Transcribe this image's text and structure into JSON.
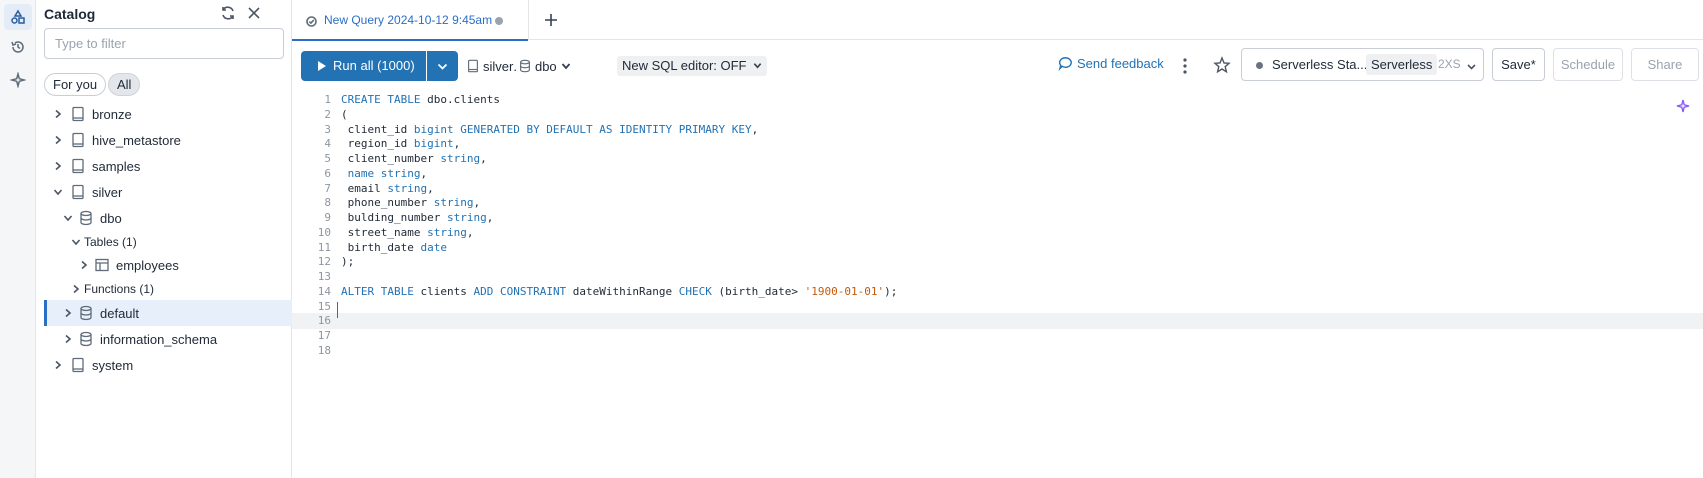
{
  "catalog": {
    "title": "Catalog",
    "filter_placeholder": "Type to filter",
    "pills": [
      "For you",
      "All"
    ],
    "items": {
      "bronze": "bronze",
      "hive_metastore": "hive_metastore",
      "samples": "samples",
      "silver": "silver",
      "dbo": "dbo",
      "tables": "Tables (1)",
      "employees": "employees",
      "functions": "Functions (1)",
      "default": "default",
      "information_schema": "information_schema",
      "system": "system"
    }
  },
  "tabs": [
    {
      "label": "New Query 2024-10-12 9:45am"
    }
  ],
  "toolbar": {
    "run_label": "Run all (1000)",
    "catalog": "silver",
    "schema": "dbo",
    "sql_editor_toggle": "New SQL editor: OFF",
    "feedback": "Send feedback",
    "compute_name": "Serverless Sta...",
    "compute_type": "Serverless",
    "compute_size": "2XS",
    "save": "Save*",
    "schedule": "Schedule",
    "share": "Share"
  },
  "editor": {
    "current_line": 16,
    "lines": [
      "<span class=\"kw\">CREATE TABLE</span> dbo.clients",
      "(",
      " client_id <span class=\"kw\">bigint GENERATED BY DEFAULT AS IDENTITY PRIMARY KEY</span>,",
      " region_id <span class=\"kw\">bigint</span>,",
      " client_number <span class=\"kw\">string</span>,",
      " <span class=\"kw\">name string</span>,",
      " email <span class=\"kw\">string</span>,",
      " phone_number <span class=\"kw\">string</span>,",
      " bulding_number <span class=\"kw\">string</span>,",
      " street_name <span class=\"kw\">string</span>,",
      " birth_date <span class=\"kw\">date</span>",
      ");",
      "",
      "<span class=\"kw\">ALTER TABLE</span> clients <span class=\"kw\">ADD CONSTRAINT</span> dateWithinRange <span class=\"kw\">CHECK</span> (birth_date&gt; <span class=\"str\">'1900-01-01'</span>);",
      "",
      "",
      "",
      ""
    ]
  },
  "colors": {
    "accent": "#2272b4",
    "selected_row": "#e7f0fa",
    "string_literal": "#c4590d"
  }
}
